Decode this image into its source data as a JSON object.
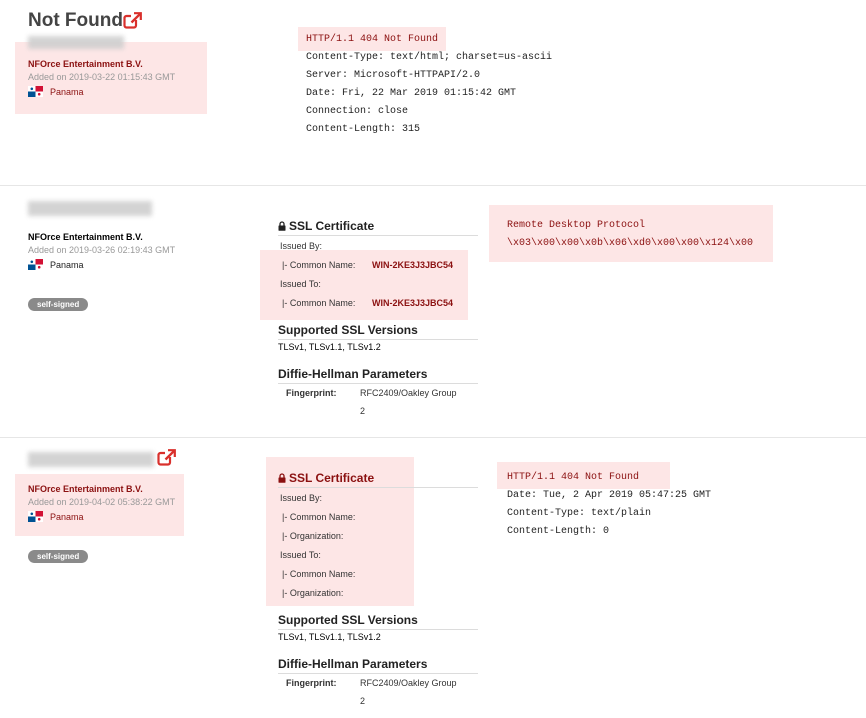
{
  "colors": {
    "highlight": "#fde6e6",
    "accent_red": "#8b1010",
    "tag_gray": "#8a8a8a",
    "external_link": "#d9302c"
  },
  "page": {
    "title": "Not Found"
  },
  "records": [
    {
      "org": "NFOrce Entertainment B.V.",
      "added": "Added on 2019-03-22 01:15:43 GMT",
      "country": "Panama",
      "banner": {
        "status": "HTTP/1.1 404 Not Found",
        "lines": [
          "Content-Type: text/html; charset=us-ascii",
          "Server: Microsoft-HTTPAPI/2.0",
          "Date: Fri, 22 Mar 2019 01:15:42 GMT",
          "Connection: close",
          "Content-Length: 315"
        ]
      }
    },
    {
      "org": "NFOrce Entertainment B.V.",
      "added": "Added on 2019-03-26 02:19:43 GMT",
      "country": "Panama",
      "tag": "self-signed",
      "ssl": {
        "title": "SSL Certificate",
        "issued_by": "Issued By:",
        "issued_to": "Issued To:",
        "common_name_label": "|- Common Name:",
        "issuer_cn": "WIN-2KE3J3JBC54",
        "subject_cn": "WIN-2KE3J3JBC54",
        "versions_title": "Supported SSL Versions",
        "versions": "TLSv1, TLSv1.1, TLSv1.2",
        "dh_title": "Diffie-Hellman Parameters",
        "fingerprint_label": "Fingerprint:",
        "fingerprint_value": "RFC2409/Oakley Group",
        "fingerprint_value_2": "2"
      },
      "banner": {
        "title": "Remote Desktop Protocol",
        "data": "\\x03\\x00\\x00\\x0b\\x06\\xd0\\x00\\x00\\x124\\x00"
      }
    },
    {
      "org": "NFOrce Entertainment B.V.",
      "added": "Added on 2019-04-02 05:38:22 GMT",
      "country": "Panama",
      "tag": "self-signed",
      "ssl": {
        "title": "SSL Certificate",
        "issued_by": "Issued By:",
        "issued_to": "Issued To:",
        "common_name_label": "|- Common Name:",
        "organization_label": "|- Organization:",
        "versions_title": "Supported SSL Versions",
        "versions": "TLSv1, TLSv1.1, TLSv1.2",
        "dh_title": "Diffie-Hellman Parameters",
        "fingerprint_label": "Fingerprint:",
        "fingerprint_value": "RFC2409/Oakley Group",
        "fingerprint_value_2": "2"
      },
      "banner": {
        "status": "HTTP/1.1 404 Not Found",
        "lines": [
          "Date: Tue, 2 Apr 2019 05:47:25 GMT",
          "Content-Type: text/plain",
          "Content-Length: 0"
        ]
      }
    }
  ]
}
